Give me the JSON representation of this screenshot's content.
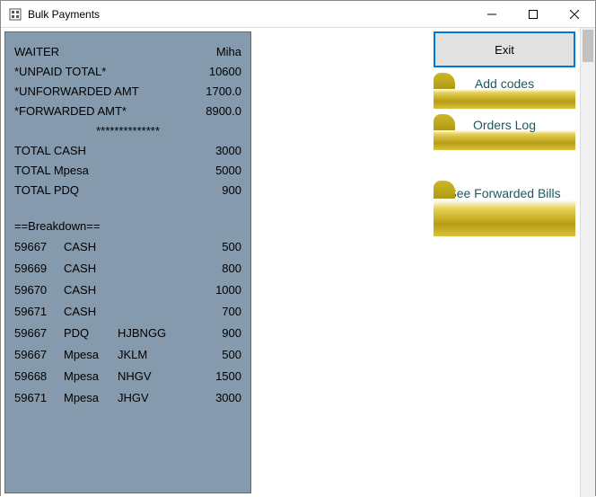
{
  "window": {
    "title": "Bulk Payments"
  },
  "summary": {
    "waiter_label": "WAITER",
    "waiter_value": "Miha",
    "unpaid_label": "*UNPAID TOTAL*",
    "unpaid_value": "10600",
    "unforwarded_label": "*UNFORWARDED AMT",
    "unforwarded_value": "1700.0",
    "forwarded_label": "*FORWARDED AMT*",
    "forwarded_value": "8900.0",
    "stars": "**************",
    "total_cash_label": "TOTAL CASH",
    "total_cash_value": "3000",
    "total_mpesa_label": "TOTAL Mpesa",
    "total_mpesa_value": "5000",
    "total_pdq_label": "TOTAL PDQ",
    "total_pdq_value": "900",
    "breakdown_header": "==Breakdown=="
  },
  "breakdown": [
    {
      "id": "59667",
      "method": "CASH",
      "ref": "",
      "amount": "500"
    },
    {
      "id": "59669",
      "method": "CASH",
      "ref": "",
      "amount": "800"
    },
    {
      "id": "59670",
      "method": "CASH",
      "ref": "",
      "amount": "1000"
    },
    {
      "id": "59671",
      "method": "CASH",
      "ref": "",
      "amount": "700"
    },
    {
      "id": "59667",
      "method": "PDQ",
      "ref": "HJBNGG",
      "amount": "900"
    },
    {
      "id": "59667",
      "method": "Mpesa",
      "ref": "JKLM",
      "amount": "500"
    },
    {
      "id": "59668",
      "method": "Mpesa",
      "ref": "NHGV",
      "amount": "1500"
    },
    {
      "id": "59671",
      "method": "Mpesa",
      "ref": "JHGV",
      "amount": "3000"
    }
  ],
  "buttons": {
    "exit": "Exit",
    "add_codes": "Add codes",
    "orders_log": "Orders Log",
    "see_forwarded": "See Forwarded Bills"
  }
}
